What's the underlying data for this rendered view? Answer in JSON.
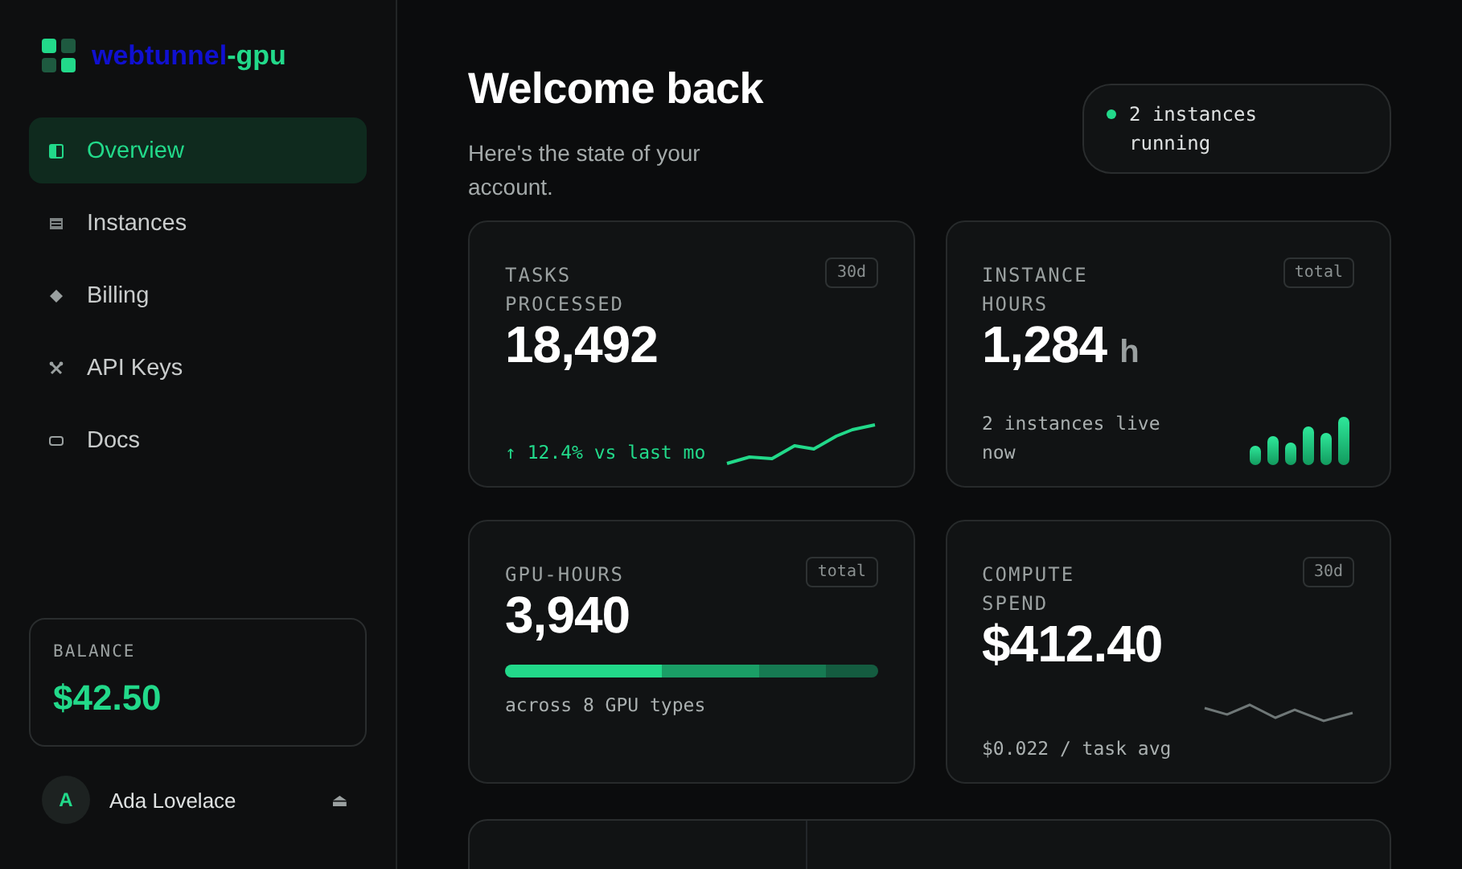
{
  "brand": {
    "name": "webtunnel",
    "suffix": "-gpu"
  },
  "nav": [
    {
      "label": "Overview",
      "selected": true
    },
    {
      "label": "Instances",
      "selected": false
    },
    {
      "label": "Billing",
      "selected": false
    },
    {
      "label": "API Keys",
      "selected": false
    },
    {
      "label": "Docs",
      "selected": false
    }
  ],
  "balance": {
    "label": "BALANCE",
    "value": "$42.50"
  },
  "user": {
    "initial": "A",
    "name": "Ada Lovelace",
    "action": "⏏"
  },
  "header": {
    "title": "Welcome back",
    "subtitle": "Here's the state of your account."
  },
  "status": {
    "text": "2 instances running",
    "color": "#22d98a"
  },
  "cards": [
    {
      "kind": "sparkline",
      "label": "TASKS PROCESSED",
      "badge": "30d",
      "value": "18,492",
      "note": "↑ 12.4% vs last mo",
      "positive": true
    },
    {
      "kind": "bars",
      "label": "INSTANCE HOURS",
      "badge": "total",
      "value": "1,284",
      "unit": "h",
      "note": "2 instances live now",
      "positive": false
    },
    {
      "kind": "progress",
      "label": "GPU-HOURS",
      "badge": "total",
      "value": "3,940",
      "note": "across 8 GPU types",
      "positive": false
    },
    {
      "kind": "flatline",
      "label": "COMPUTE SPEND",
      "badge": "30d",
      "value": "$412.40",
      "note": "$0.022 / task avg",
      "positive": false
    }
  ]
}
